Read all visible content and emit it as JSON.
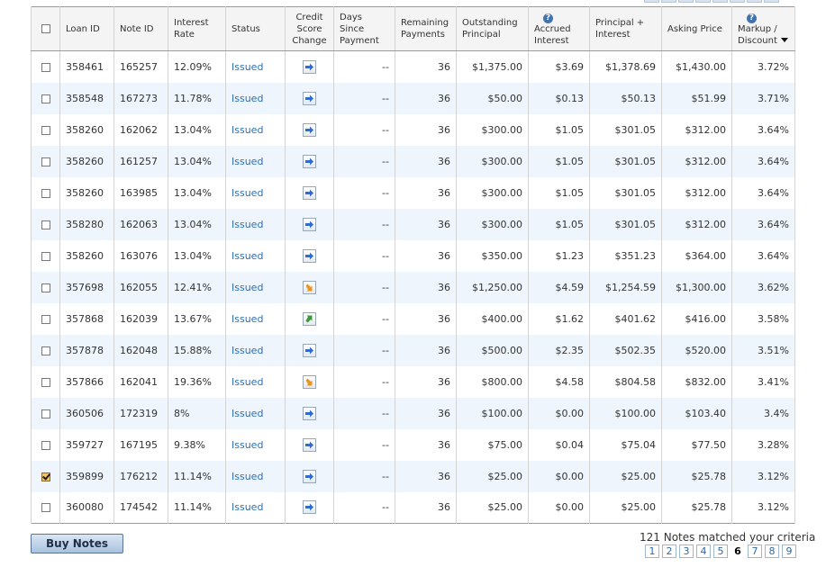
{
  "headers": {
    "loan_id": "Loan ID",
    "note_id": "Note ID",
    "interest_rate": "Interest Rate",
    "status": "Status",
    "credit_score_change": "Credit Score Change",
    "days_since_payment": "Days Since Payment",
    "remaining_payments": "Remaining Payments",
    "outstanding_principal": "Outstanding Principal",
    "accrued_interest": "Accrued Interest",
    "principal_interest": "Principal + Interest",
    "asking_price": "Asking Price",
    "markup_discount": "Markup / Discount"
  },
  "help_glyph": "?",
  "rows": [
    {
      "checked": false,
      "loan_id": "358461",
      "note_id": "165257",
      "rate": "12.09%",
      "status": "Issued",
      "credit": "flat",
      "days": "--",
      "remaining": "36",
      "principal": "$1,375.00",
      "accrued": "$3.69",
      "pi": "$1,378.69",
      "asking": "$1,430.00",
      "markup": "3.72%"
    },
    {
      "checked": false,
      "loan_id": "358548",
      "note_id": "167273",
      "rate": "11.78%",
      "status": "Issued",
      "credit": "flat",
      "days": "--",
      "remaining": "36",
      "principal": "$50.00",
      "accrued": "$0.13",
      "pi": "$50.13",
      "asking": "$51.99",
      "markup": "3.71%"
    },
    {
      "checked": false,
      "loan_id": "358260",
      "note_id": "162062",
      "rate": "13.04%",
      "status": "Issued",
      "credit": "flat",
      "days": "--",
      "remaining": "36",
      "principal": "$300.00",
      "accrued": "$1.05",
      "pi": "$301.05",
      "asking": "$312.00",
      "markup": "3.64%"
    },
    {
      "checked": false,
      "loan_id": "358260",
      "note_id": "161257",
      "rate": "13.04%",
      "status": "Issued",
      "credit": "flat",
      "days": "--",
      "remaining": "36",
      "principal": "$300.00",
      "accrued": "$1.05",
      "pi": "$301.05",
      "asking": "$312.00",
      "markup": "3.64%"
    },
    {
      "checked": false,
      "loan_id": "358260",
      "note_id": "163985",
      "rate": "13.04%",
      "status": "Issued",
      "credit": "flat",
      "days": "--",
      "remaining": "36",
      "principal": "$300.00",
      "accrued": "$1.05",
      "pi": "$301.05",
      "asking": "$312.00",
      "markup": "3.64%"
    },
    {
      "checked": false,
      "loan_id": "358280",
      "note_id": "162063",
      "rate": "13.04%",
      "status": "Issued",
      "credit": "flat",
      "days": "--",
      "remaining": "36",
      "principal": "$300.00",
      "accrued": "$1.05",
      "pi": "$301.05",
      "asking": "$312.00",
      "markup": "3.64%"
    },
    {
      "checked": false,
      "loan_id": "358260",
      "note_id": "163076",
      "rate": "13.04%",
      "status": "Issued",
      "credit": "flat",
      "days": "--",
      "remaining": "36",
      "principal": "$350.00",
      "accrued": "$1.23",
      "pi": "$351.23",
      "asking": "$364.00",
      "markup": "3.64%"
    },
    {
      "checked": false,
      "loan_id": "357698",
      "note_id": "162055",
      "rate": "12.41%",
      "status": "Issued",
      "credit": "down",
      "days": "--",
      "remaining": "36",
      "principal": "$1,250.00",
      "accrued": "$4.59",
      "pi": "$1,254.59",
      "asking": "$1,300.00",
      "markup": "3.62%"
    },
    {
      "checked": false,
      "loan_id": "357868",
      "note_id": "162039",
      "rate": "13.67%",
      "status": "Issued",
      "credit": "up",
      "days": "--",
      "remaining": "36",
      "principal": "$400.00",
      "accrued": "$1.62",
      "pi": "$401.62",
      "asking": "$416.00",
      "markup": "3.58%"
    },
    {
      "checked": false,
      "loan_id": "357878",
      "note_id": "162048",
      "rate": "15.88%",
      "status": "Issued",
      "credit": "flat",
      "days": "--",
      "remaining": "36",
      "principal": "$500.00",
      "accrued": "$2.35",
      "pi": "$502.35",
      "asking": "$520.00",
      "markup": "3.51%"
    },
    {
      "checked": false,
      "loan_id": "357866",
      "note_id": "162041",
      "rate": "19.36%",
      "status": "Issued",
      "credit": "down",
      "days": "--",
      "remaining": "36",
      "principal": "$800.00",
      "accrued": "$4.58",
      "pi": "$804.58",
      "asking": "$832.00",
      "markup": "3.41%"
    },
    {
      "checked": false,
      "loan_id": "360506",
      "note_id": "172319",
      "rate": "8%",
      "status": "Issued",
      "credit": "flat",
      "days": "--",
      "remaining": "36",
      "principal": "$100.00",
      "accrued": "$0.00",
      "pi": "$100.00",
      "asking": "$103.40",
      "markup": "3.4%"
    },
    {
      "checked": false,
      "loan_id": "359727",
      "note_id": "167195",
      "rate": "9.38%",
      "status": "Issued",
      "credit": "flat",
      "days": "--",
      "remaining": "36",
      "principal": "$75.00",
      "accrued": "$0.04",
      "pi": "$75.04",
      "asking": "$77.50",
      "markup": "3.28%"
    },
    {
      "checked": true,
      "loan_id": "359899",
      "note_id": "176212",
      "rate": "11.14%",
      "status": "Issued",
      "credit": "flat",
      "days": "--",
      "remaining": "36",
      "principal": "$25.00",
      "accrued": "$0.00",
      "pi": "$25.00",
      "asking": "$25.78",
      "markup": "3.12%"
    },
    {
      "checked": false,
      "loan_id": "360080",
      "note_id": "174542",
      "rate": "11.14%",
      "status": "Issued",
      "credit": "flat",
      "days": "--",
      "remaining": "36",
      "principal": "$25.00",
      "accrued": "$0.00",
      "pi": "$25.00",
      "asking": "$25.78",
      "markup": "3.12%"
    }
  ],
  "buy_button": "Buy Notes",
  "match_text": "121 Notes matched your criteria",
  "pagination": {
    "pages": [
      "1",
      "2",
      "3",
      "4",
      "5",
      "6",
      "7",
      "8",
      "9"
    ],
    "current": "6"
  },
  "colors": {
    "flat_arrow": "#2f6bd0",
    "down_arrow": "#e8961e",
    "up_arrow": "#3a9a3a",
    "status_link": "#2d6fb3",
    "row_alt": "#eef5fc"
  }
}
